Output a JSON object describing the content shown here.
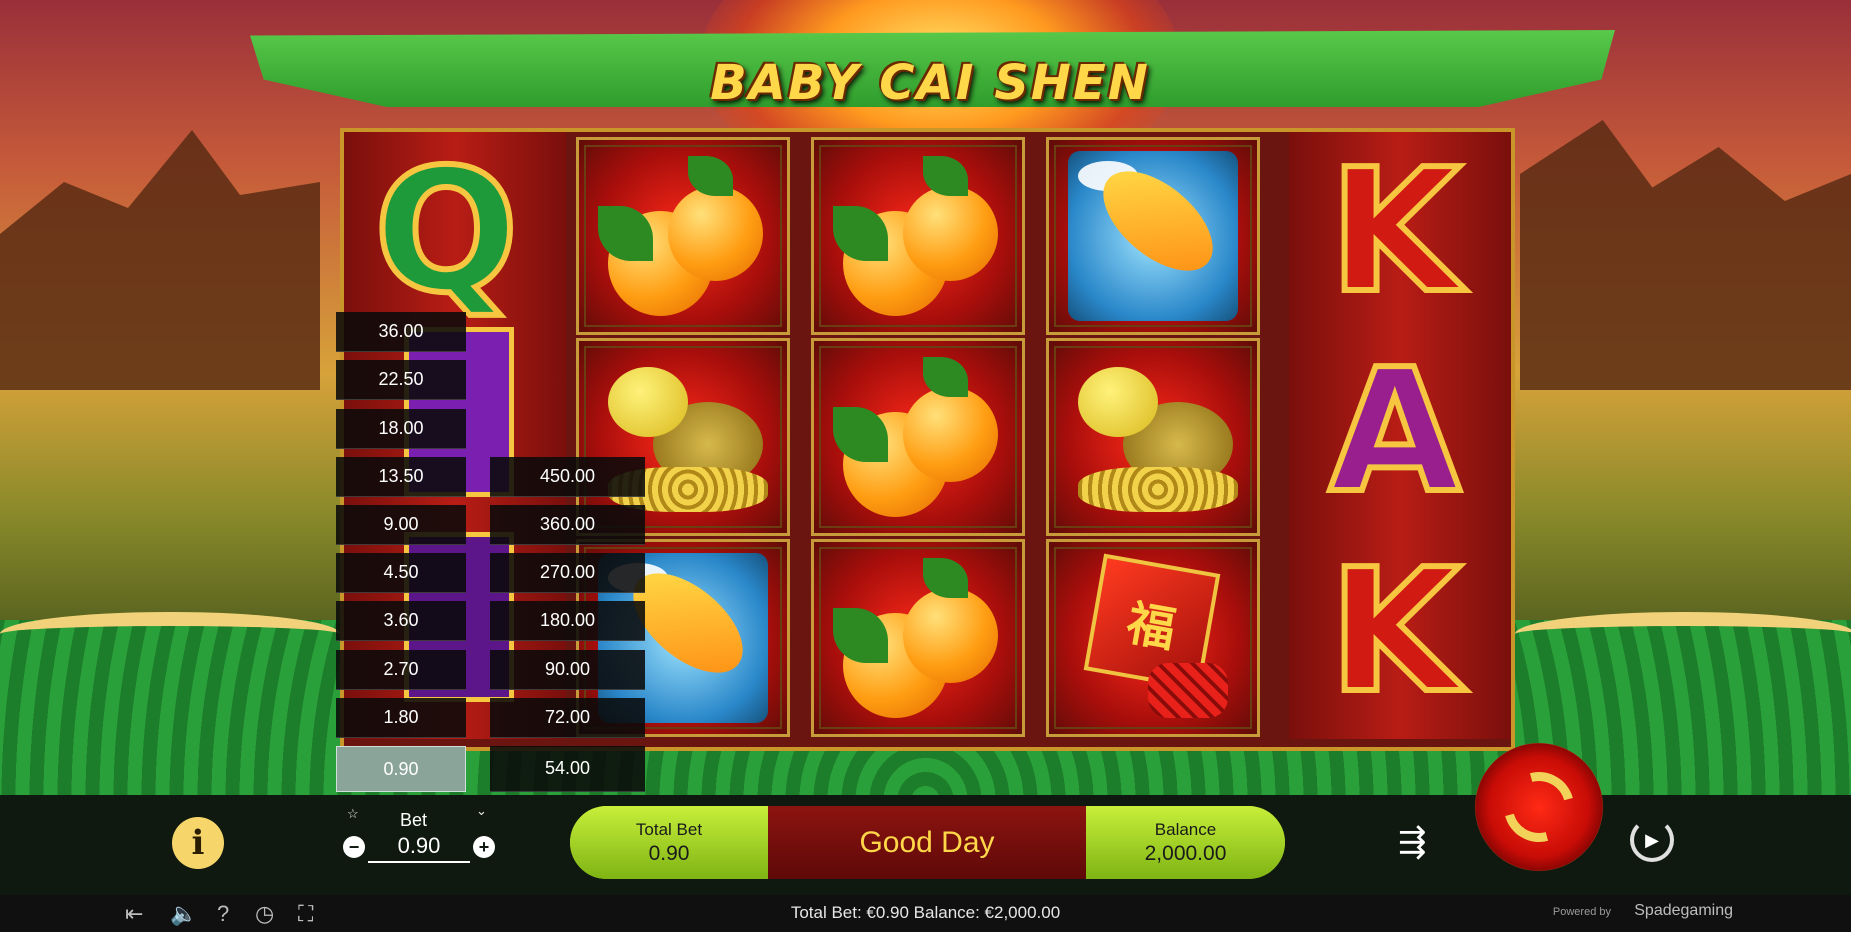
{
  "game": {
    "title": "BABY CAI SHEN",
    "colors": {
      "accent_gold": "#f7c640",
      "panel_green": "#a7d321",
      "panel_red": "#8c1410"
    }
  },
  "reels": {
    "columns": [
      {
        "symbols": [
          "Q",
          "Q",
          "Q"
        ]
      },
      {
        "symbols": [
          "orange-icon",
          "turtle-icon",
          "koi-icon"
        ]
      },
      {
        "symbols": [
          "orange-icon",
          "orange-icon",
          "orange-icon"
        ]
      },
      {
        "symbols": [
          "koi-icon",
          "turtle-icon",
          "firecracker-icon"
        ]
      },
      {
        "symbols": [
          "K",
          "A",
          "K"
        ]
      }
    ],
    "firecracker_char": "福",
    "letters": {
      "q1": "Q",
      "k1": "K",
      "a1": "A",
      "k2": "K"
    }
  },
  "bet_dropdown": {
    "left_column": [
      "36.00",
      "22.50",
      "18.00",
      "13.50",
      "9.00",
      "4.50",
      "3.60",
      "2.70",
      "1.80",
      "0.90"
    ],
    "right_column": [
      "450.00",
      "360.00",
      "270.00",
      "180.00",
      "90.00",
      "72.00",
      "54.00"
    ],
    "selected": "0.90"
  },
  "controls": {
    "info_label": "i",
    "bet_label": "Bet",
    "bet_value": "0.90",
    "minus": "−",
    "plus": "+",
    "star_icon": "☆",
    "chevron_icon": "⌄"
  },
  "panel": {
    "total_bet_label": "Total Bet",
    "total_bet_value": "0.90",
    "message": "Good Day",
    "balance_label": "Balance",
    "balance_value": "2,000.00"
  },
  "status_bar": {
    "summary": "Total Bet: €0.90  Balance: €2,000.00",
    "powered_by": "Powered by",
    "brand": "Spadegaming",
    "icons": [
      "exit-icon",
      "sound-icon",
      "help-icon",
      "history-icon",
      "fullscreen-icon"
    ]
  }
}
